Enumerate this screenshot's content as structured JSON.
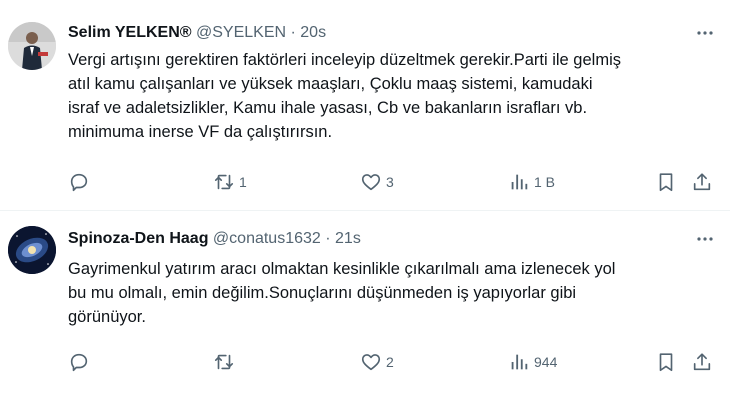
{
  "tweets": [
    {
      "display_name": "Selim YELKEN®",
      "handle": "@SYELKEN",
      "separator": "·",
      "time": "20s",
      "text": "Vergi artışını gerektiren faktörleri inceleyip düzeltmek gerekir.Parti ile gelmiş\natıl kamu çalışanları ve yüksek maaşları, Çoklu maaş sistemi, kamudaki\nisraf ve adaletsizlikler, Kamu ihale yasası, Cb ve bakanların israfları vb.\nminimuma inerse  VF da çalıştırırsın.",
      "reply_count": "",
      "retweet_count": "1",
      "like_count": "3",
      "view_count": "1 B"
    },
    {
      "display_name": "Spinoza-Den Haag",
      "handle": "@conatus1632",
      "separator": "·",
      "time": "21s",
      "text": "Gayrimenkul yatırım aracı olmaktan kesinlikle çıkarılmalı ama izlenecek yol\nbu mu olmalı, emin değilim.Sonuçlarını düşünmeden iş yapıyorlar gibi\ngörünüyor.",
      "reply_count": "",
      "retweet_count": "",
      "like_count": "2",
      "view_count": "944"
    }
  ],
  "colors": {
    "text": "#0f1419",
    "secondary": "#536471",
    "divider": "#eff3f4"
  },
  "icons": [
    "more-icon",
    "reply-icon",
    "retweet-icon",
    "like-icon",
    "views-icon",
    "bookmark-icon",
    "share-icon"
  ]
}
